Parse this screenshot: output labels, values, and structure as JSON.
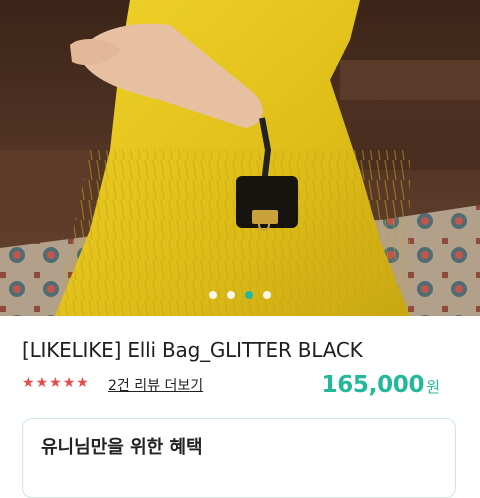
{
  "product": {
    "title": "[LIKELIKE] Elli Bag_GLITTER BLACK",
    "rating_stars": 5,
    "review_link": "2건 리뷰 더보기",
    "price": "165,000",
    "price_unit": "원"
  },
  "carousel": {
    "slide_count": 4,
    "active_index": 2,
    "image_subject": "photo-yellow-dress-black-bag"
  },
  "benefit": {
    "title": "유니님만을 위한 혜택"
  },
  "colors": {
    "accent": "#23b89a",
    "star": "#e84a4a",
    "dress": "#e2c21f"
  }
}
